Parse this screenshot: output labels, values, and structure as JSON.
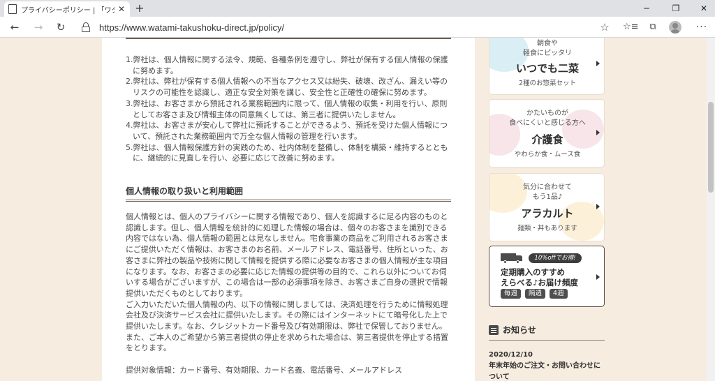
{
  "browser": {
    "tab_title": "プライバシーポリシー | 「ワタミの宅食ダ",
    "new_tab": "+",
    "url": "https://www.watami-takushoku-direct.jp/policy/",
    "window_min": "─",
    "window_max": "❐",
    "window_close": "✕"
  },
  "article": {
    "principles": [
      "1.弊社は、個人情報に関する法令、規範、各種条例を遵守し、弊社が保有する個人情報の保護に努めます。",
      "2.弊社は、弊社が保有する個人情報への不当なアクセス又は紛失、破壊、改ざん、漏えい等のリスクの可能性を認識し、適正な安全対策を講じ、安全性と正確性の確保に努めます。",
      "3.弊社は、お客さまから預託される業務範囲内に限って、個人情報の収集・利用を行い、原則としてお客さま及び情報主体の同意無くしては、第三者に提供いたしません。",
      "4.弊社は、お客さまが安心して弊社に預託することができるよう、預託を受けた個人情報について、預託された業務範囲内で万全な個人情報の管理を行います。",
      "5.弊社は、個人情報保護方針の実践のため、社内体制を整備し、体制を構築・維持するとともに、継続的に見直しを行い、必要に応じて改善に努めます。"
    ],
    "section_title": "個人情報の取り扱いと利用範囲",
    "paragraphs": [
      "個人情報とは、個人のプライバシーに関する情報であり、個人を認識するに足る内容のものと認識します。但し、個人情報を統計的に処理した情報の場合は、個々のお客さまを識別できる内容ではない為、個人情報の範囲とは見なしません。宅食事業の商品をご利用されるお客さまにご提供いただく情報は、お客さまのお名前、メールアドレス、電話番号、住所といった、お客さまに弊社の製品や技術に関して情報を提供する際に必要なお客さまの個人情報が主な項目になります。なお、お客さまの必要に応じた情報の提供等の目的で、これら以外についてお伺いする場合がございますが、この場合は一部の必須事項を除き、お客さまご自身の選択で情報提供いただくものとしております。",
      "ご入力いただいた個人情報の内、以下の情報に関しましては、決済処理を行うために情報処理会社及び決済サービス会社に提供いたします。その際にはインターネットにて暗号化した上で提供いたします。なお、クレジットカード番号及び有効期限は、弊社で保管しておりません。",
      "また、ご本人のご希望から第三者提供の停止を求められた場合は、第三者提供を停止する措置をとります。"
    ],
    "provided_info": "提供対象情報：カード番号、有効期限、カード名義、電話番号、メールアドレス"
  },
  "sidebar": {
    "cards": [
      {
        "tag_line1": "朝食や",
        "tag_line2": "軽食にピッタリ",
        "title": "いつでも二菜",
        "sub": "2種のお惣菜セット",
        "accent": "#cde9f2"
      },
      {
        "tag_line1": "かたいものが",
        "tag_line2": "食べにくいと感じる方へ",
        "title": "介護食",
        "sub": "やわらか食・ムース食",
        "accent": "#f6dce3"
      },
      {
        "tag_line1": "気分に合わせて",
        "tag_line2": "もう1品♪",
        "title": "アラカルト",
        "sub": "麺類・丼もあります",
        "accent": "#fbeccb"
      }
    ],
    "subscription": {
      "promo": "10%offでお得!",
      "title_line1": "定期購入のすすめ",
      "title_line2": "えらべる♪お届け頻度",
      "pills": [
        "毎週",
        "隔週",
        "4週"
      ]
    },
    "news": {
      "label": "お知らせ",
      "date": "2020/12/10",
      "title": "年末年始のご注文・お問い合わせについて"
    }
  }
}
